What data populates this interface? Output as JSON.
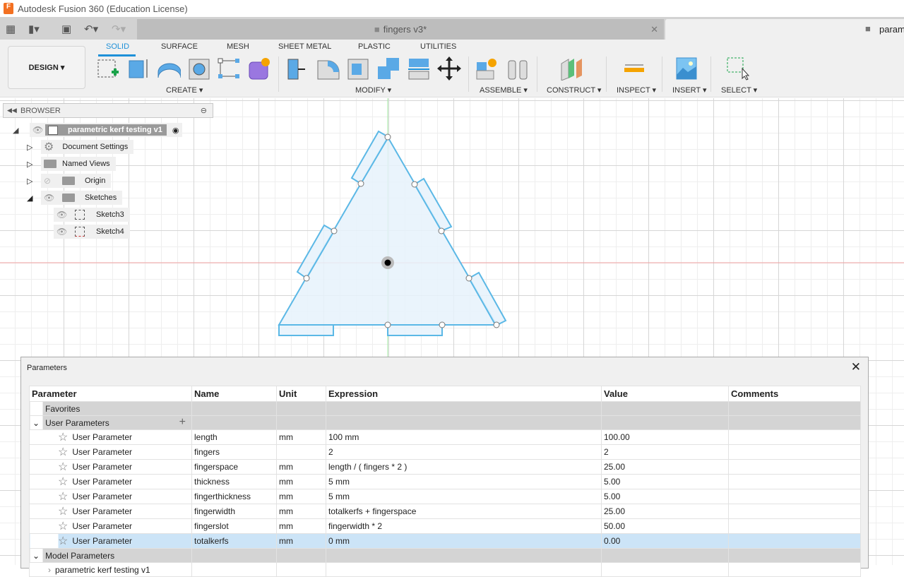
{
  "app": {
    "title": "Autodesk Fusion 360 (Education License)",
    "logo": "F"
  },
  "tabs": [
    {
      "label": "fingers v3*"
    },
    {
      "label": "param"
    }
  ],
  "toolbar": {
    "workspace": "DESIGN",
    "tabs": [
      "SOLID",
      "SURFACE",
      "MESH",
      "SHEET METAL",
      "PLASTIC",
      "UTILITIES"
    ],
    "active_tab": "SOLID",
    "groups": [
      "CREATE",
      "MODIFY",
      "ASSEMBLE",
      "CONSTRUCT",
      "INSPECT",
      "INSERT",
      "SELECT"
    ],
    "accent": "#1e90d8"
  },
  "browser": {
    "title": "BROWSER",
    "root": "parametric kerf testing v1",
    "items": [
      {
        "label": "Document Settings"
      },
      {
        "label": "Named Views"
      },
      {
        "label": "Origin"
      },
      {
        "label": "Sketches"
      },
      {
        "label": "Sketch3"
      },
      {
        "label": "Sketch4"
      }
    ]
  },
  "sketch": {
    "profile_color": "#5bb8e6",
    "fill": "#e6f2fb"
  },
  "parameters": {
    "title": "Parameters",
    "columns": [
      "Parameter",
      "Name",
      "Unit",
      "Expression",
      "Value",
      "Comments"
    ],
    "favorites": "Favorites",
    "user_group": "User Parameters",
    "model_group": "Model Parameters",
    "model_child": "parametric kerf testing v1",
    "rows": [
      {
        "type": "User Parameter",
        "name": "length",
        "unit": "mm",
        "expr": "100 mm",
        "value": "100.00"
      },
      {
        "type": "User Parameter",
        "name": "fingers",
        "unit": "",
        "expr": "2",
        "value": "2"
      },
      {
        "type": "User Parameter",
        "name": "fingerspace",
        "unit": "mm",
        "expr": "length / ( fingers * 2 )",
        "value": "25.00"
      },
      {
        "type": "User Parameter",
        "name": "thickness",
        "unit": "mm",
        "expr": "5 mm",
        "value": "5.00"
      },
      {
        "type": "User Parameter",
        "name": "fingerthickness",
        "unit": "mm",
        "expr": "5 mm",
        "value": "5.00"
      },
      {
        "type": "User Parameter",
        "name": "fingerwidth",
        "unit": "mm",
        "expr": "totalkerfs + fingerspace",
        "value": "25.00"
      },
      {
        "type": "User Parameter",
        "name": "fingerslot",
        "unit": "mm",
        "expr": "fingerwidth * 2",
        "value": "50.00"
      },
      {
        "type": "User Parameter",
        "name": "totalkerfs",
        "unit": "mm",
        "expr": "0 mm",
        "value": "0.00",
        "selected": true
      }
    ]
  }
}
